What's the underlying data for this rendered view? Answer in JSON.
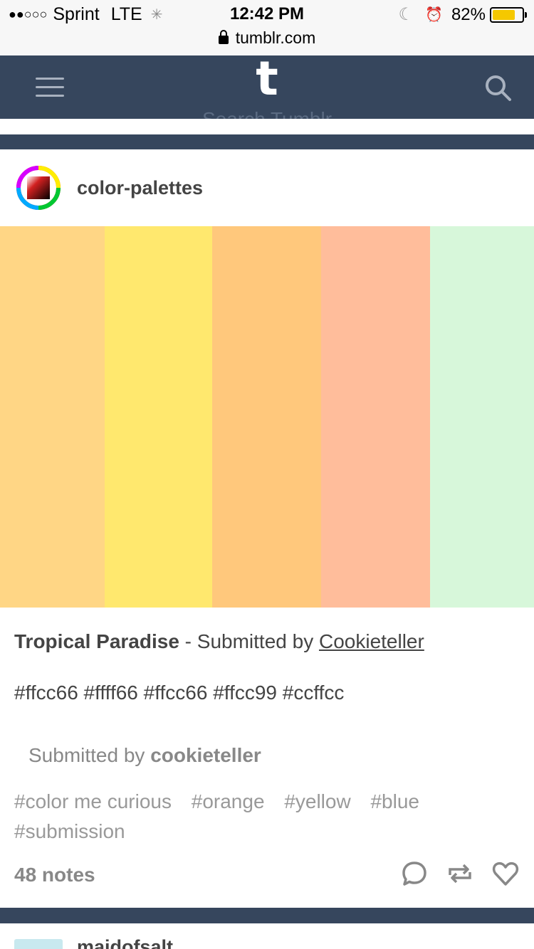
{
  "status_bar": {
    "signal": "●●○○○",
    "carrier": "Sprint",
    "network": "LTE",
    "time": "12:42 PM",
    "battery": "82%",
    "battery_level": 0.82,
    "url": "tumblr.com"
  },
  "header": {
    "logo": "t",
    "search_placeholder": "Search Tumblr"
  },
  "post": {
    "blog_name": "color-palettes",
    "palette": [
      "#ffd685",
      "#ffe86e",
      "#ffc87c",
      "#ffbd9b",
      "#d7f7da"
    ],
    "title": "Tropical Paradise",
    "separator": " - Submitted by ",
    "submitter_link": "Cookieteller",
    "hex_codes": "#ffcc66 #ffff66 #ffcc66 #ffcc99 #ccffcc",
    "submitted_prefix": "Submitted by ",
    "submitted_user": "cookieteller",
    "tags": [
      "#color me curious",
      "#orange",
      "#yellow",
      "#blue",
      "#submission"
    ],
    "notes": "48 notes"
  },
  "next_post": {
    "blog_name": "maidofsalt"
  },
  "icons": [
    "menu-icon",
    "search-icon",
    "comment-icon",
    "reblog-icon",
    "heart-icon",
    "lock-icon",
    "alarm-icon",
    "moon-icon"
  ],
  "colors": {
    "header_bg": "#36465d",
    "battery": "#f5c800"
  }
}
